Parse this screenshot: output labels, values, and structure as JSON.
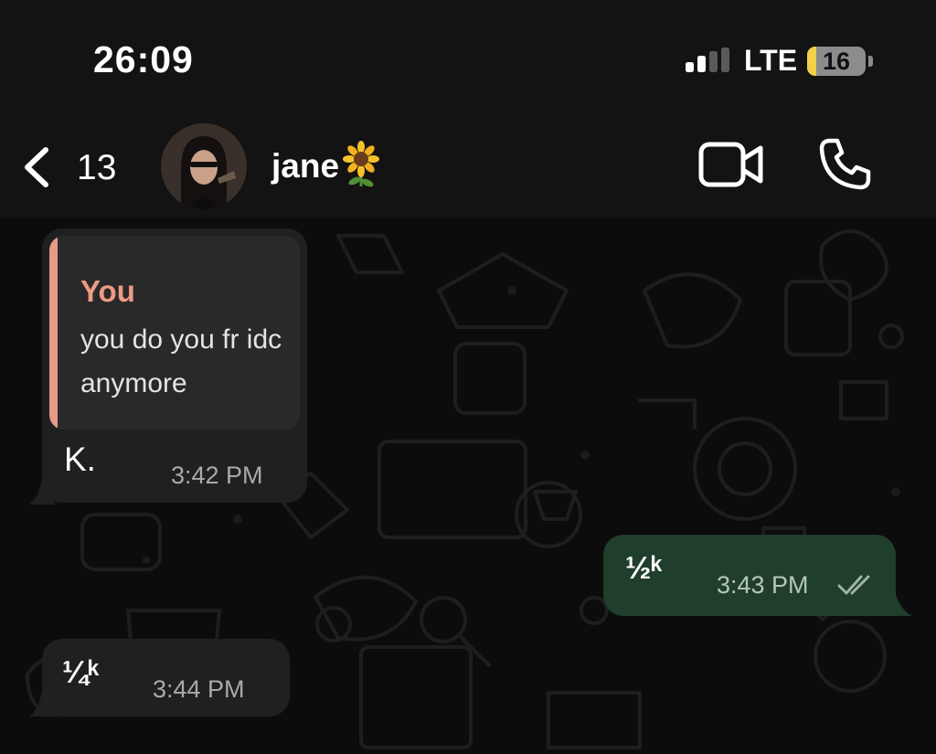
{
  "status_bar": {
    "time": "26:09",
    "network": "LTE",
    "battery": "16",
    "battery_level_percent": 16
  },
  "header": {
    "back_count": "13",
    "contact_name": "jane",
    "name_emoji": "sunflower-icon"
  },
  "messages": [
    {
      "direction": "incoming",
      "reply_to": {
        "author": "You",
        "text": "you do you fr idc anymore"
      },
      "text": "K.",
      "time": "3:42 PM"
    },
    {
      "direction": "outgoing",
      "text": "½ᵏ",
      "time": "3:43 PM",
      "status": "read"
    },
    {
      "direction": "incoming",
      "text": "¼ᵏ",
      "time": "3:44 PM"
    }
  ],
  "colors": {
    "background": "#0b0c0b",
    "incoming_bubble": "#1f2020",
    "outgoing_bubble": "#1f3e2b",
    "quote_accent": "#ee9b84",
    "battery_accent": "#f3cf4a"
  }
}
